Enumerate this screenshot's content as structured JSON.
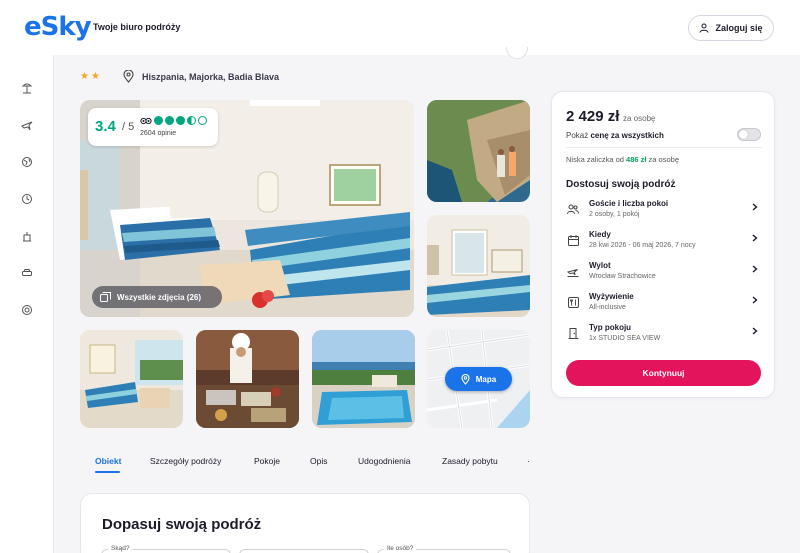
{
  "header": {
    "logo": "eSky",
    "tagline": "Twoje biuro podróży",
    "login_label": "Zaloguj się"
  },
  "sidebar": {
    "items": [
      "beach-icon",
      "flight-icon",
      "globe-icon",
      "clock-icon",
      "hotel-icon",
      "car-icon",
      "lifebuoy-icon"
    ]
  },
  "hotel": {
    "stars": "★★",
    "location": "Hiszpania, Majorka, Badia Blava"
  },
  "rating": {
    "score": "3.4",
    "max": "/ 5",
    "reviews": "2604 opinie",
    "level": 3.5
  },
  "gallery": {
    "all_photos_label": "Wszystkie zdjęcia (26)",
    "map_label": "Mapa"
  },
  "tabs": [
    "Obiekt",
    "Szczegóły podróży",
    "Pokoje",
    "Opis",
    "Udogodnienia",
    "Zasady pobytu",
    "·"
  ],
  "lower": {
    "title": "Dopasuj swoją podróż",
    "field_from": "Skąd?",
    "field_people": "Ile osób?"
  },
  "booking": {
    "price": "2 429 zł",
    "price_unit": "za osobę",
    "toggle_prefix": "Pokaż ",
    "toggle_bold": "cenę za wszystkich",
    "deposit_prefix": "Niska zaliczka od ",
    "deposit_amount": "486 zł",
    "deposit_suffix": " za osobę",
    "customize_title": "Dostosuj swoją podróż",
    "options": [
      {
        "icon": "guests-icon",
        "title": "Goście i liczba pokoi",
        "subtitle": "2 osoby, 1 pokój"
      },
      {
        "icon": "calendar-icon",
        "title": "Kiedy",
        "subtitle": "28 kwi 2026 - 06 maj 2026, 7 nocy"
      },
      {
        "icon": "departure-icon",
        "title": "Wylot",
        "subtitle": "Wrocław Strachowice"
      },
      {
        "icon": "meal-icon",
        "title": "Wyżywienie",
        "subtitle": "All-inclusive"
      },
      {
        "icon": "room-icon",
        "title": "Typ pokoju",
        "subtitle": "1x STUDIO SEA VIEW"
      }
    ],
    "cta_label": "Kontynuuj"
  },
  "colors": {
    "brand": "#1a73e8",
    "cta": "#e4145c",
    "rating": "#00a680",
    "deposit": "#00a35c"
  }
}
